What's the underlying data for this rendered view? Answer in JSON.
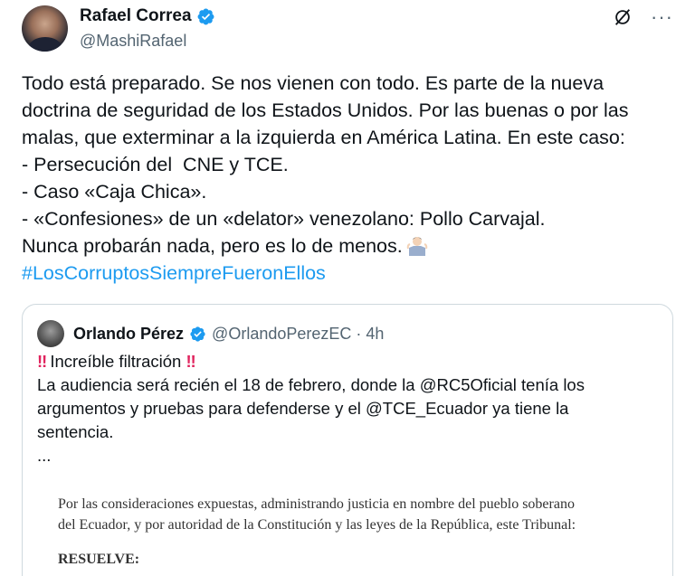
{
  "author": {
    "name": "Rafael Correa",
    "handle": "@MashiRafael"
  },
  "icons": {
    "verified": "verified-badge-icon",
    "grok": "grok-icon",
    "more": "more-icon",
    "shrug": "shrug-emoji"
  },
  "colors": {
    "link": "#1d9bf0",
    "verified": "#1d9bf0",
    "secondary_text": "#536471",
    "border": "#cfd9de"
  },
  "tweet": {
    "lines": [
      "Todo está preparado. Se nos vienen con todo. Es parte de la nueva",
      "doctrina de seguridad de los Estados Unidos. Por las buenas o por las",
      "malas, que exterminar a la izquierda en América Latina. En este caso:",
      "- Persecución del  CNE y TCE.",
      "- Caso «Caja Chica».",
      "- «Confesiones» de un «delator» venezolano: Pollo Carvajal.",
      "Nunca probarán nada, pero es lo de menos."
    ],
    "hashtag": "#LosCorruptosSiempreFueronEllos"
  },
  "quote": {
    "name": "Orlando Pérez",
    "meta": "@OrlandoPerezEC · 4h",
    "bang": "‼",
    "headline": "Increíble filtración",
    "lines": [
      "La audiencia será recién el 18 de febrero, donde la @RC5Oficial tenía los",
      "argumentos y pruebas para defenderse y el @TCE_Ecuador ya tiene la",
      "sentencia.",
      "..."
    ],
    "document": {
      "line1": "Por las consideraciones expuestas, administrando justicia en nombre del pueblo soberano",
      "line2": "del Ecuador, y por autoridad de la Constitución y las leyes de la República, este Tribunal:",
      "title": "RESUELVE:"
    }
  }
}
